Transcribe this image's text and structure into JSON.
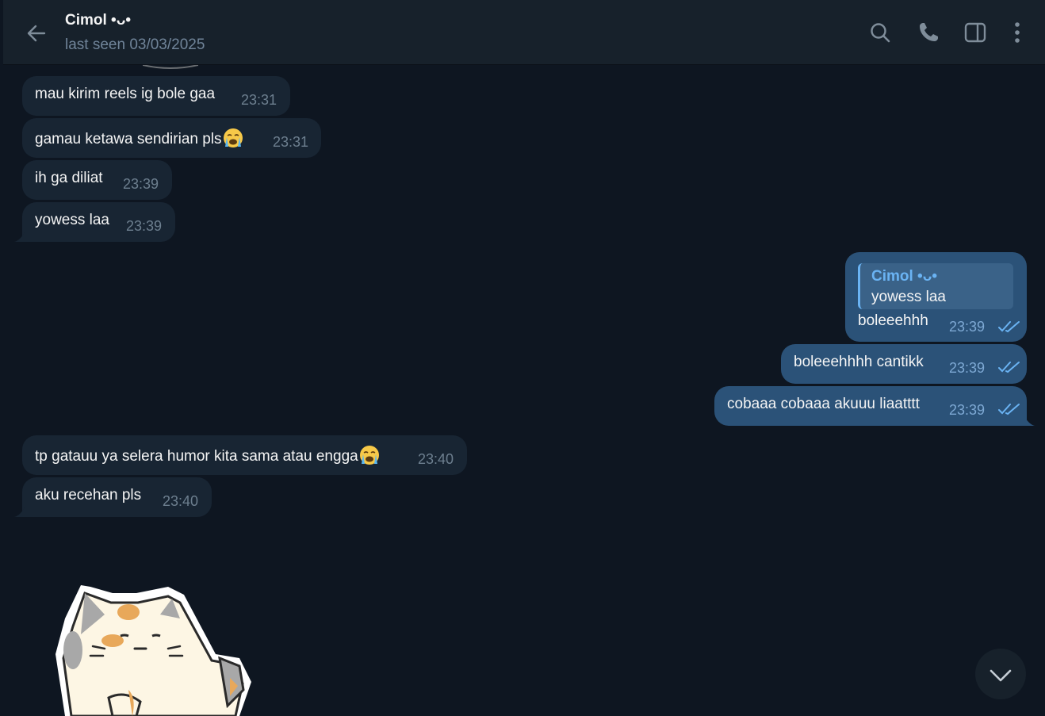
{
  "header": {
    "contact_name": "Cimol •ᴗ•",
    "status": "last seen 03/03/2025"
  },
  "icons": {
    "back": "arrow-left-icon",
    "search": "search-icon",
    "call": "phone-icon",
    "sidebar": "sidebar-toggle-icon",
    "menu": "more-vertical-icon",
    "scroll": "chevron-down-icon",
    "read": "double-check-icon",
    "emoji": "loudly-crying-face-emoji"
  },
  "messages": [
    {
      "dir": "in",
      "text": "mau kirim reels ig bole gaa",
      "time": "23:31"
    },
    {
      "dir": "in",
      "text": "gamau ketawa sendirian pls",
      "emoji": "😭",
      "time": "23:31"
    },
    {
      "dir": "in",
      "text": "ih ga diliat",
      "time": "23:39"
    },
    {
      "dir": "in",
      "text": "yowess laa",
      "time": "23:39"
    },
    {
      "dir": "out",
      "reply_to": {
        "name": "Cimol •ᴗ•",
        "text": "yowess laa"
      },
      "text": "boleeehhh",
      "time": "23:39",
      "read": true
    },
    {
      "dir": "out",
      "text": "boleeehhhh cantikk",
      "time": "23:39",
      "read": true
    },
    {
      "dir": "out",
      "text": "cobaaa cobaaa akuuu liaatttt",
      "time": "23:39",
      "read": true
    },
    {
      "dir": "in",
      "text": "tp gatauu ya selera humor kita sama atau engga",
      "emoji": "😭",
      "time": "23:40"
    },
    {
      "dir": "in",
      "text": "aku recehan pls",
      "time": "23:40"
    }
  ],
  "colors": {
    "background": "#0e1621",
    "header": "#17212b",
    "incoming_bubble": "#182533",
    "outgoing_bubble": "#2b5278",
    "accent": "#6ab3f3",
    "muted_text": "#708499"
  }
}
